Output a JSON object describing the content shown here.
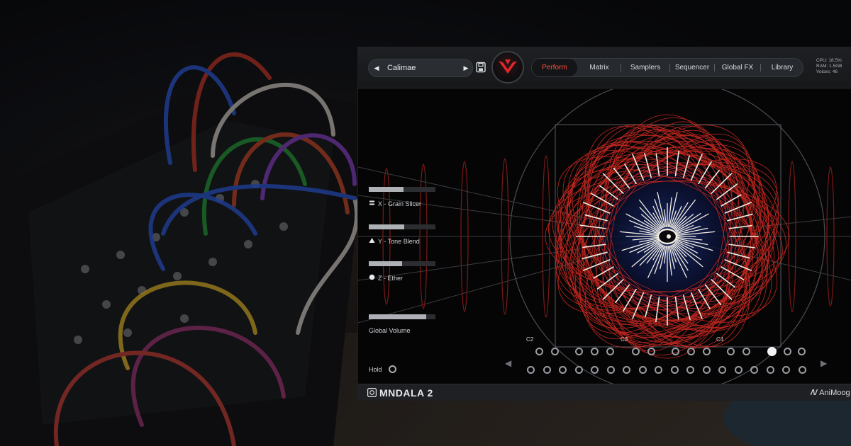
{
  "preset": {
    "name": "Calimae"
  },
  "tabs": [
    {
      "label": "Perform"
    },
    {
      "label": "Matrix"
    },
    {
      "label": "Samplers"
    },
    {
      "label": "Sequencer"
    },
    {
      "label": "Global FX"
    },
    {
      "label": "Library"
    }
  ],
  "active_tab": "Perform",
  "stats": {
    "cpu": "CPU: 18.5%",
    "ram": "RAM: 1.5GB",
    "voices": "Voices: 46"
  },
  "params": {
    "x": {
      "label": "X - Grain Slicer",
      "value": 0.52
    },
    "y": {
      "label": "Y - Tone Blend",
      "value": 0.53
    },
    "z": {
      "label": "Z - Ether",
      "value": 0.5
    },
    "global_volume": {
      "label": "Global Volume",
      "value": 0.86
    }
  },
  "hold": {
    "label": "Hold"
  },
  "keyboard": {
    "octaves": [
      "C2",
      "C3",
      "C4"
    ],
    "active_key": "upper-row-12"
  },
  "footer": {
    "brand": "MNDALA 2",
    "vendor": "AniMoog"
  },
  "colors": {
    "accent": "#ff4e3a",
    "viz_red": "#d42a22",
    "panel": "#050506"
  },
  "icons": {
    "x_param": "parallel-lines-icon",
    "y_param": "triangle-icon",
    "z_param": "circle-icon",
    "save": "floppy-disk-icon",
    "logo": "mndala-logo-icon"
  }
}
